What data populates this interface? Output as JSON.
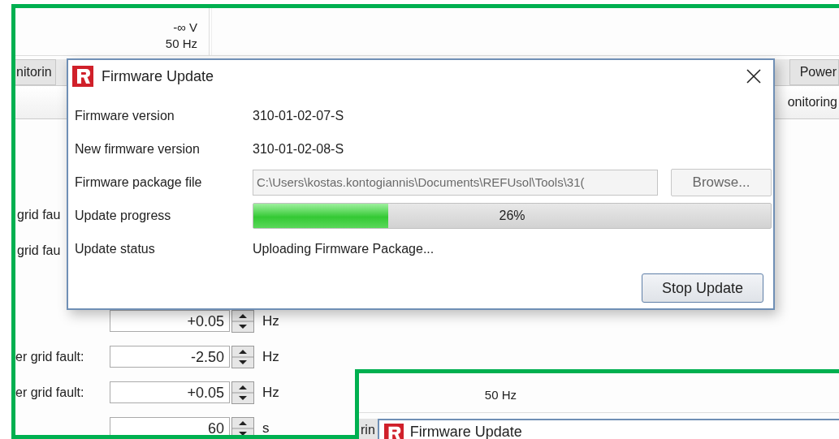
{
  "background_window": {
    "readings": [
      "-∞ V",
      "50 Hz"
    ],
    "tabs": [
      {
        "label": "nitorin"
      },
      {
        "label": "Power"
      }
    ],
    "sub_tab": "onitoring",
    "fault_labels": [
      "grid fau",
      "grid fau"
    ],
    "fields": [
      {
        "value": "+0.05",
        "unit": "Hz"
      },
      {
        "label": "er grid fault:",
        "value": "-2.50",
        "unit": "Hz"
      },
      {
        "label": "er grid fault:",
        "value": "+0.05",
        "unit": "Hz"
      },
      {
        "value": "60",
        "unit": "s"
      }
    ]
  },
  "dialog": {
    "title": "Firmware Update",
    "rows": [
      {
        "kind": "text",
        "label": "Firmware version",
        "value": "310-01-02-07-S"
      },
      {
        "kind": "text",
        "label": "New firmware version",
        "value": "310-01-02-08-S"
      },
      {
        "kind": "file",
        "label": "Firmware package file",
        "value": "C:\\Users\\kostas.kontogiannis\\Documents\\REFUsol\\Tools\\31(",
        "button": "Browse..."
      },
      {
        "kind": "progress",
        "label": "Update progress",
        "level": 0.26,
        "reading": "26%"
      },
      {
        "kind": "text",
        "label": "Update status",
        "value": "Uploading Firmware Package..."
      }
    ],
    "button": "Stop Update"
  },
  "inset": {
    "reading": "50 Hz",
    "tab": "rin",
    "dialog_title": "Firmware Update"
  }
}
